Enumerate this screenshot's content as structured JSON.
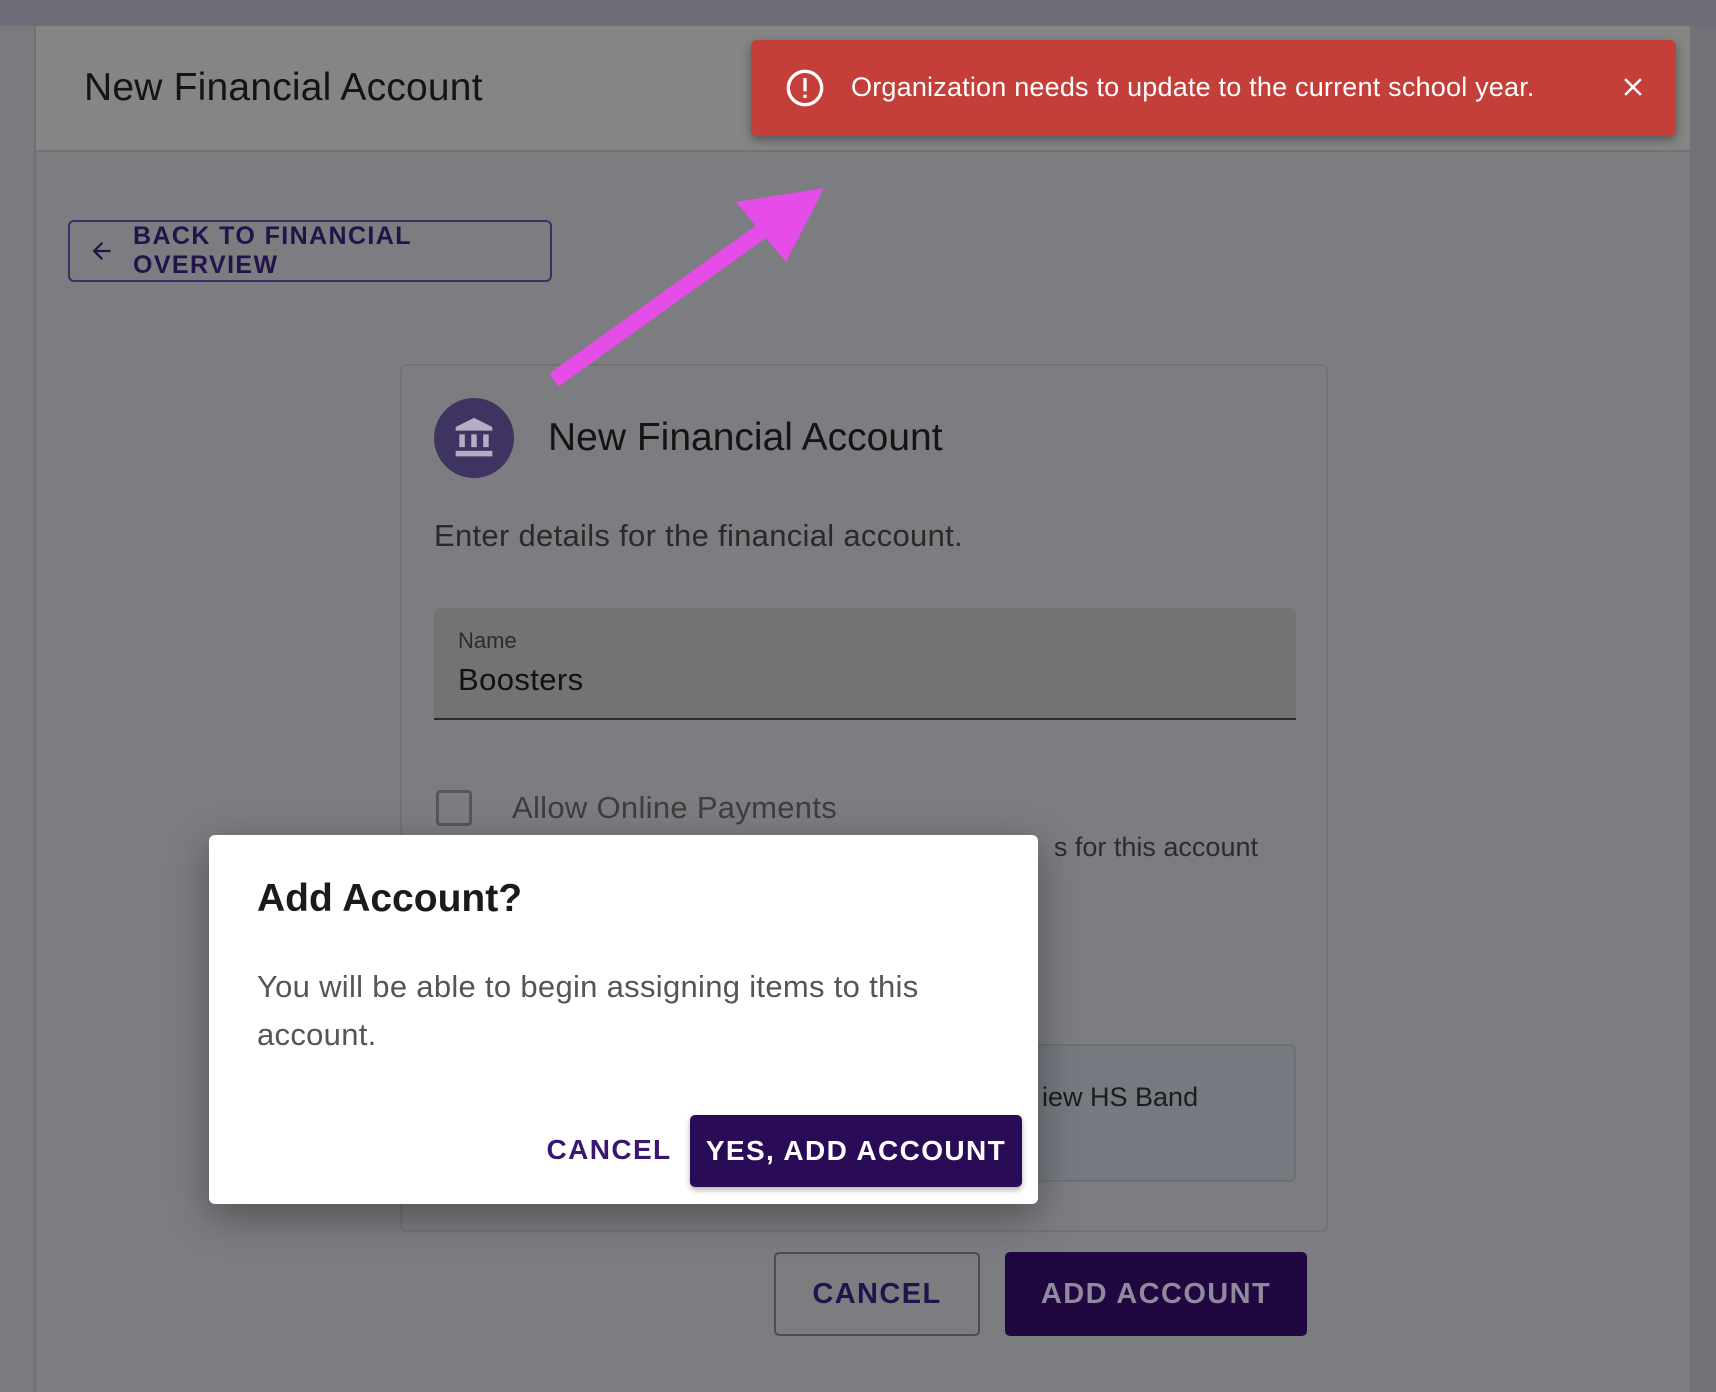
{
  "page": {
    "title": "New Financial Account",
    "back_button": "BACK TO FINANCIAL OVERVIEW"
  },
  "card": {
    "icon": "bank-icon",
    "title": "New Financial Account",
    "subtitle": "Enter details for the financial account.",
    "name_field": {
      "label": "Name",
      "value": "Boosters"
    },
    "online_payments": {
      "label": "Allow Online Payments",
      "checked": false,
      "help_fragment": "s for this account"
    },
    "organization_fragment": "iew HS Band"
  },
  "footer": {
    "cancel_label": "CANCEL",
    "add_label": "ADD ACCOUNT"
  },
  "toast": {
    "icon": "alert-circle-icon",
    "message": "Organization needs to update to the current school year.",
    "close_icon": "close-icon",
    "color": "#c43e3a"
  },
  "dialog": {
    "title": "Add Account?",
    "body": "You will be able to begin assigning items to this account.",
    "cancel_label": "CANCEL",
    "confirm_label": "YES, ADD ACCOUNT"
  },
  "annotation": {
    "arrow_color": "#e64ce8"
  },
  "colors": {
    "brand_purple": "#2a0b55",
    "accent_text": "#3b1670"
  }
}
